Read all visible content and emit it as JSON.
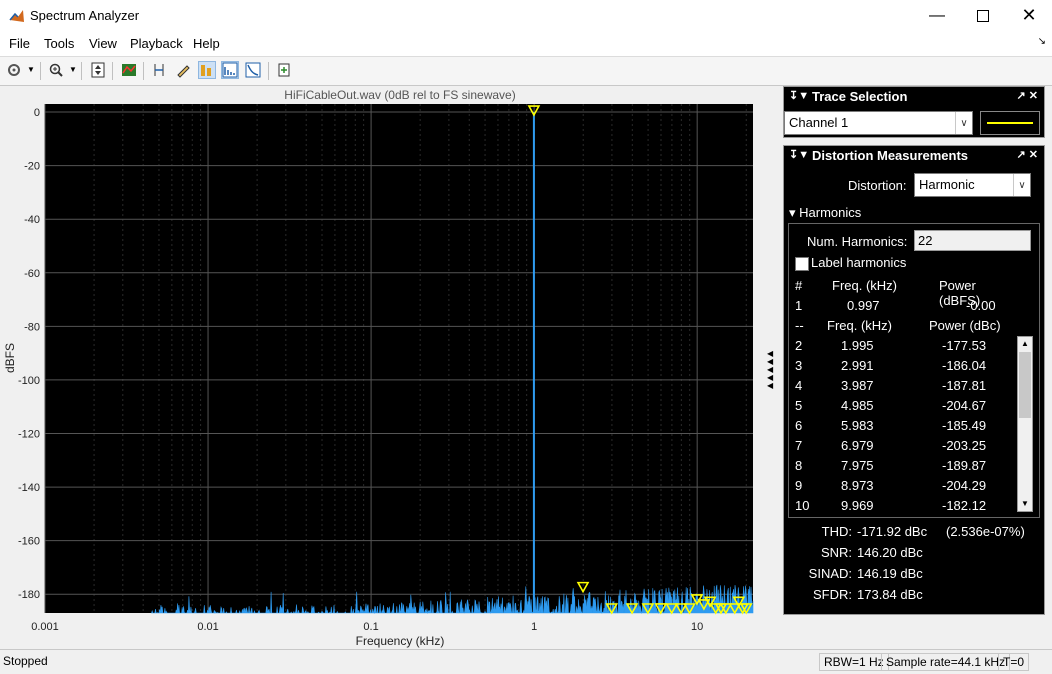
{
  "window": {
    "title": "Spectrum Analyzer",
    "min_icon": "minimize-icon",
    "max_icon": "maximize-icon",
    "close_icon": "close-icon"
  },
  "menu": [
    "File",
    "Tools",
    "View",
    "Playback",
    "Help"
  ],
  "plot": {
    "title": "HiFiCableOut.wav   (0dB rel to FS sinewave)",
    "ylabel": "dBFS",
    "xlabel": "Frequency (kHz)",
    "yticks": [
      "0",
      "-20",
      "-40",
      "-60",
      "-80",
      "-100",
      "-120",
      "-140",
      "-160",
      "-180"
    ],
    "xticks": [
      "0.001",
      "0.01",
      "0.1",
      "1",
      "10"
    ],
    "background": "#000000",
    "trace_color": "#2e9bf0",
    "marker_color": "#ffff00"
  },
  "chart_data": {
    "type": "line",
    "xscale": "log",
    "xlim": [
      0.001,
      22
    ],
    "ylim": [
      -187,
      3
    ],
    "fundamental": {
      "x": 0.997,
      "y": 0
    },
    "harmonics": [
      {
        "x": 1.995,
        "y": -177.53
      },
      {
        "x": 2.991,
        "y": -186.04
      },
      {
        "x": 3.987,
        "y": -187.81
      },
      {
        "x": 4.985,
        "y": -204.67
      },
      {
        "x": 5.983,
        "y": -185.49
      },
      {
        "x": 6.979,
        "y": -203.25
      },
      {
        "x": 7.975,
        "y": -189.87
      },
      {
        "x": 8.973,
        "y": -204.29
      },
      {
        "x": 9.969,
        "y": -182.12
      }
    ]
  },
  "trace_selection": {
    "title": "Trace Selection",
    "channel": "Channel 1",
    "swatch_color": "#ffff00"
  },
  "distortion": {
    "title": "Distortion Measurements",
    "distortion_label": "Distortion:",
    "distortion_value": "Harmonic",
    "harmonics_header": "Harmonics",
    "num_harmonics_label": "Num. Harmonics:",
    "num_harmonics_value": "22",
    "label_harmonics": "Label harmonics",
    "head1": {
      "c1": "#",
      "c2": "Freq. (kHz)",
      "c3": "Power (dBFS)"
    },
    "fund": {
      "c1": "1",
      "c2": "0.997",
      "c3": "-0.00"
    },
    "head2": {
      "c1": "--",
      "c2": "Freq. (kHz)",
      "c3": "Power (dBc)"
    },
    "rows": [
      {
        "n": "2",
        "f": "1.995",
        "p": "-177.53"
      },
      {
        "n": "3",
        "f": "2.991",
        "p": "-186.04"
      },
      {
        "n": "4",
        "f": "3.987",
        "p": "-187.81"
      },
      {
        "n": "5",
        "f": "4.985",
        "p": "-204.67"
      },
      {
        "n": "6",
        "f": "5.983",
        "p": "-185.49"
      },
      {
        "n": "7",
        "f": "6.979",
        "p": "-203.25"
      },
      {
        "n": "8",
        "f": "7.975",
        "p": "-189.87"
      },
      {
        "n": "9",
        "f": "8.973",
        "p": "-204.29"
      },
      {
        "n": "10",
        "f": "9.969",
        "p": "-182.12"
      }
    ],
    "summary": [
      {
        "label": "THD:",
        "value": "-171.92 dBc",
        "extra": "(2.536e-07%)"
      },
      {
        "label": "SNR:",
        "value": "146.20 dBc",
        "extra": ""
      },
      {
        "label": "SINAD:",
        "value": "146.19 dBc",
        "extra": ""
      },
      {
        "label": "SFDR:",
        "value": "173.84 dBc",
        "extra": ""
      }
    ]
  },
  "status": {
    "left": "Stopped",
    "rbw": "RBW=1 Hz",
    "rate": "Sample rate=44.1 kHz",
    "time": "T=0"
  }
}
